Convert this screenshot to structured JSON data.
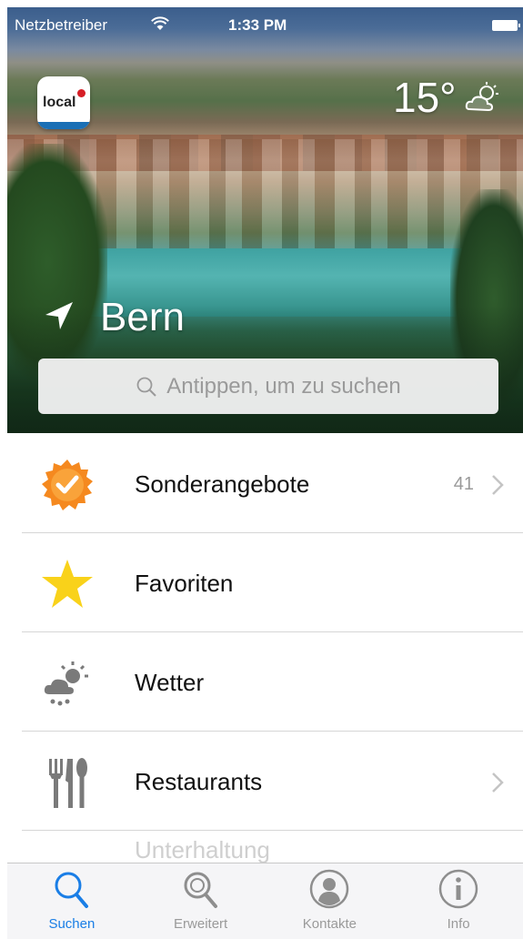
{
  "status_bar": {
    "carrier": "Netzbetreiber",
    "time": "1:33 PM"
  },
  "header": {
    "logo_text": "local",
    "temperature": "15°",
    "weather_icon": "partly-cloudy-icon",
    "city": "Bern",
    "location_icon": "location-arrow-icon"
  },
  "search": {
    "placeholder": "Antippen, um zu suchen"
  },
  "list": {
    "items": [
      {
        "label": "Sonderangebote",
        "count": "41",
        "icon": "special-offer-badge-icon",
        "chevron": true
      },
      {
        "label": "Favoriten",
        "count": "",
        "icon": "star-icon",
        "chevron": false
      },
      {
        "label": "Wetter",
        "count": "",
        "icon": "weather-icon",
        "chevron": false
      },
      {
        "label": "Restaurants",
        "count": "",
        "icon": "cutlery-icon",
        "chevron": true
      }
    ],
    "partial_label": "Unterhaltung"
  },
  "tab_bar": {
    "tabs": [
      {
        "label": "Suchen",
        "icon": "search-icon",
        "active": true
      },
      {
        "label": "Erweitert",
        "icon": "advanced-search-icon",
        "active": false
      },
      {
        "label": "Kontakte",
        "icon": "contacts-icon",
        "active": false
      },
      {
        "label": "Info",
        "icon": "info-icon",
        "active": false
      }
    ]
  },
  "colors": {
    "accent": "#1a7ee6",
    "offer_badge": "#f5891f",
    "star": "#f9d21a",
    "icon_gray": "#7a7a7a"
  }
}
